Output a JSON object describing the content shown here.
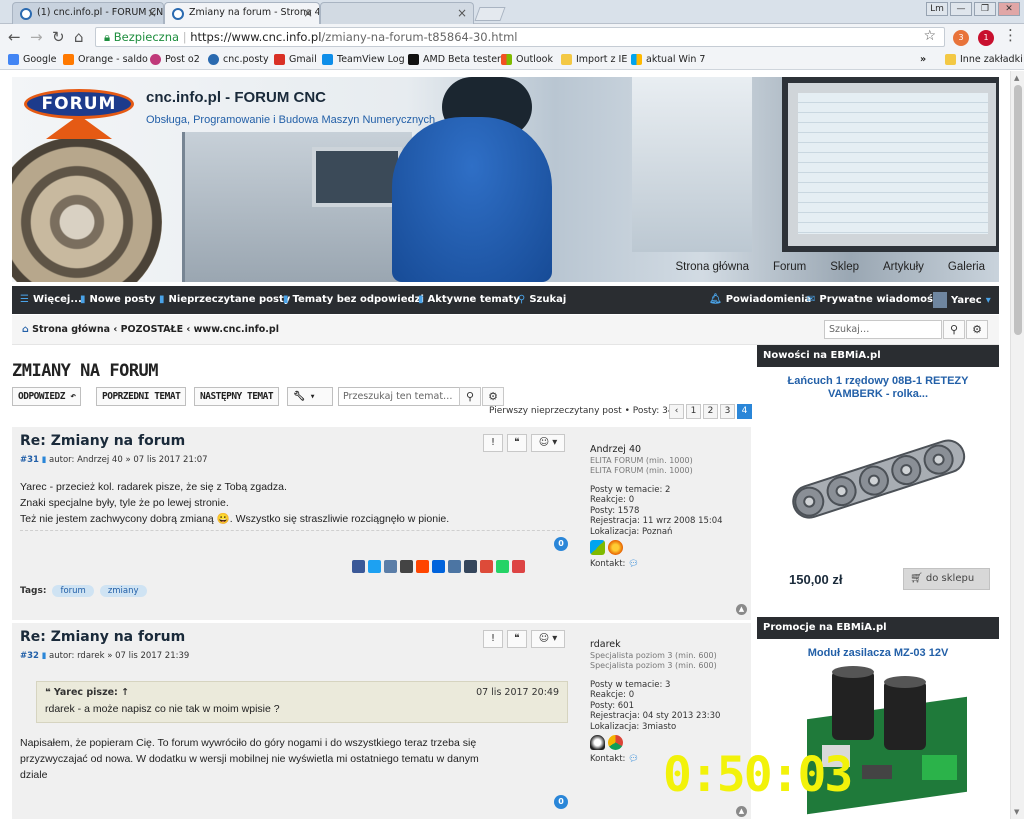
{
  "browser": {
    "tabs": [
      {
        "label": "(1) cnc.info.pl - FORUM CNC"
      },
      {
        "label": "Zmiany na forum - Strona 4"
      }
    ],
    "window_controls": {
      "user": "Lm",
      "minimize": "—",
      "restore": "❐",
      "close": "✕"
    },
    "secure_label": "Bezpieczna",
    "url_host": "https://www.cnc.info.pl",
    "url_path": "/zmiany-na-forum-t85864-30.html",
    "ext_badges": {
      "e1": "3",
      "e2": "1"
    },
    "bookmarks": [
      {
        "label": "Google",
        "color": "#4285f4"
      },
      {
        "label": "Orange - saldo",
        "color": "#ff7900"
      },
      {
        "label": "Post o2",
        "color": "#c0397a"
      },
      {
        "label": "cnc.posty",
        "color": "#2a6ab0"
      },
      {
        "label": "Gmail",
        "color": "#d93025"
      },
      {
        "label": "TeamView Log",
        "color": "#0e8ee9"
      },
      {
        "label": "AMD Beta testers",
        "color": "#111111"
      },
      {
        "label": "Outlook",
        "color": "#f25022"
      },
      {
        "label": "Import z IE",
        "color": "#f3c844"
      },
      {
        "label": "aktual Win 7",
        "color": "#00a4ef"
      }
    ],
    "bookmarks_more": "»",
    "other_bookmarks": "Inne zakładki"
  },
  "site": {
    "logo_text": "FORUM",
    "title": "cnc.info.pl - FORUM CNC",
    "description": "Obsługa, Programowanie i Budowa Maszyn Numerycznych",
    "top_links": [
      "Strona główna",
      "Forum",
      "Sklep",
      "Artykuły",
      "Galeria"
    ]
  },
  "navbar": {
    "left": [
      "Więcej...",
      "Nowe posty",
      "Nieprzeczytane posty",
      "Tematy bez odpowiedzi",
      "Aktywne tematy",
      "Szukaj"
    ],
    "notifications": "Powiadomienia",
    "messages": "Prywatne wiadomości",
    "user": "Yarec"
  },
  "breadcrumb": {
    "home": "Strona główna",
    "sep": "‹",
    "items": [
      "POZOSTAŁE",
      "www.cnc.info.pl"
    ]
  },
  "search_top": {
    "placeholder": "Szukaj…"
  },
  "topic": {
    "title": "ZMIANY NA FORUM",
    "reply_btn": "ODPOWIEDZ",
    "prev_btn": "POPRZEDNI TEMAT",
    "next_btn": "NASTĘPNY TEMAT",
    "search_placeholder": "Przeszukaj ten temat…",
    "pagination_text": "Pierwszy nieprzeczytany post • Posty: 34",
    "pages": [
      "1",
      "2",
      "3",
      "4"
    ],
    "current_page": "4"
  },
  "posts": [
    {
      "title": "Re: Zmiany na forum",
      "number": "#31",
      "meta": "autor: Andrzej 40 » 07 lis 2017 21:07",
      "body": [
        "Yarec - przecież kol. radarek pisze, że się z Tobą zgadza.",
        "Znaki specjalne były, tyle że po lewej stronie.",
        "Też nie jestem zachwycony dobrą zmianą 😀. Wszystko się straszliwie rozciągnęło w pionie."
      ],
      "likes": "0",
      "tags_label": "Tags:",
      "tags": [
        "forum",
        "zmiany"
      ],
      "profile": {
        "name": "Andrzej 40",
        "rank1": "ELITA FORUM (min. 1000)",
        "rank2": "ELITA FORUM (min. 1000)",
        "posts_in_topic": "Posty w temacie: 2",
        "reactions": "Reakcje: 0",
        "posts": "Posty: 1578",
        "registered": "Rejestracja: 11 wrz 2008 15:04",
        "location": "Lokalizacja: Poznań",
        "contact": "Kontakt:"
      }
    },
    {
      "title": "Re: Zmiany na forum",
      "number": "#32",
      "meta": "autor: rdarek » 07 lis 2017 21:39",
      "quote_author": "Yarec pisze: ↑",
      "quote_date": "07 lis 2017 20:49",
      "quote_body": "rdarek - a może napisz co nie tak w moim wpisie ?",
      "body": [
        "Napisałem, że popieram Cię. To forum wywróciło do góry nogami i do wszystkiego teraz trzeba się",
        "przyzwyczajać od nowa. W dodatku w wersji mobilnej nie wyświetla mi ostatniego tematu w danym",
        "dziale"
      ],
      "likes": "0",
      "profile": {
        "name": "rdarek",
        "rank1": "Specjalista poziom 3 (min. 600)",
        "rank2": "Specjalista poziom 3 (min. 600)",
        "posts_in_topic": "Posty w temacie: 3",
        "reactions": "Reakcje: 0",
        "posts": "Posty: 601",
        "registered": "Rejestracja: 04 sty 2013 23:30",
        "location": "Lokalizacja: 3miasto",
        "contact": "Kontakt:"
      }
    }
  ],
  "sidebar": {
    "box1_title": "Nowości na EBMiA.pl",
    "product1": "Łańcuch 1 rzędowy 08B-1 RETEZY VAMBERK - rolka...",
    "price1": "150,00 zł",
    "buy": "do sklepu",
    "box2_title": "Promocje na EBMiA.pl",
    "product2": "Moduł zasilacza MZ-03 12V"
  },
  "overlay_timer": "0:50:03"
}
